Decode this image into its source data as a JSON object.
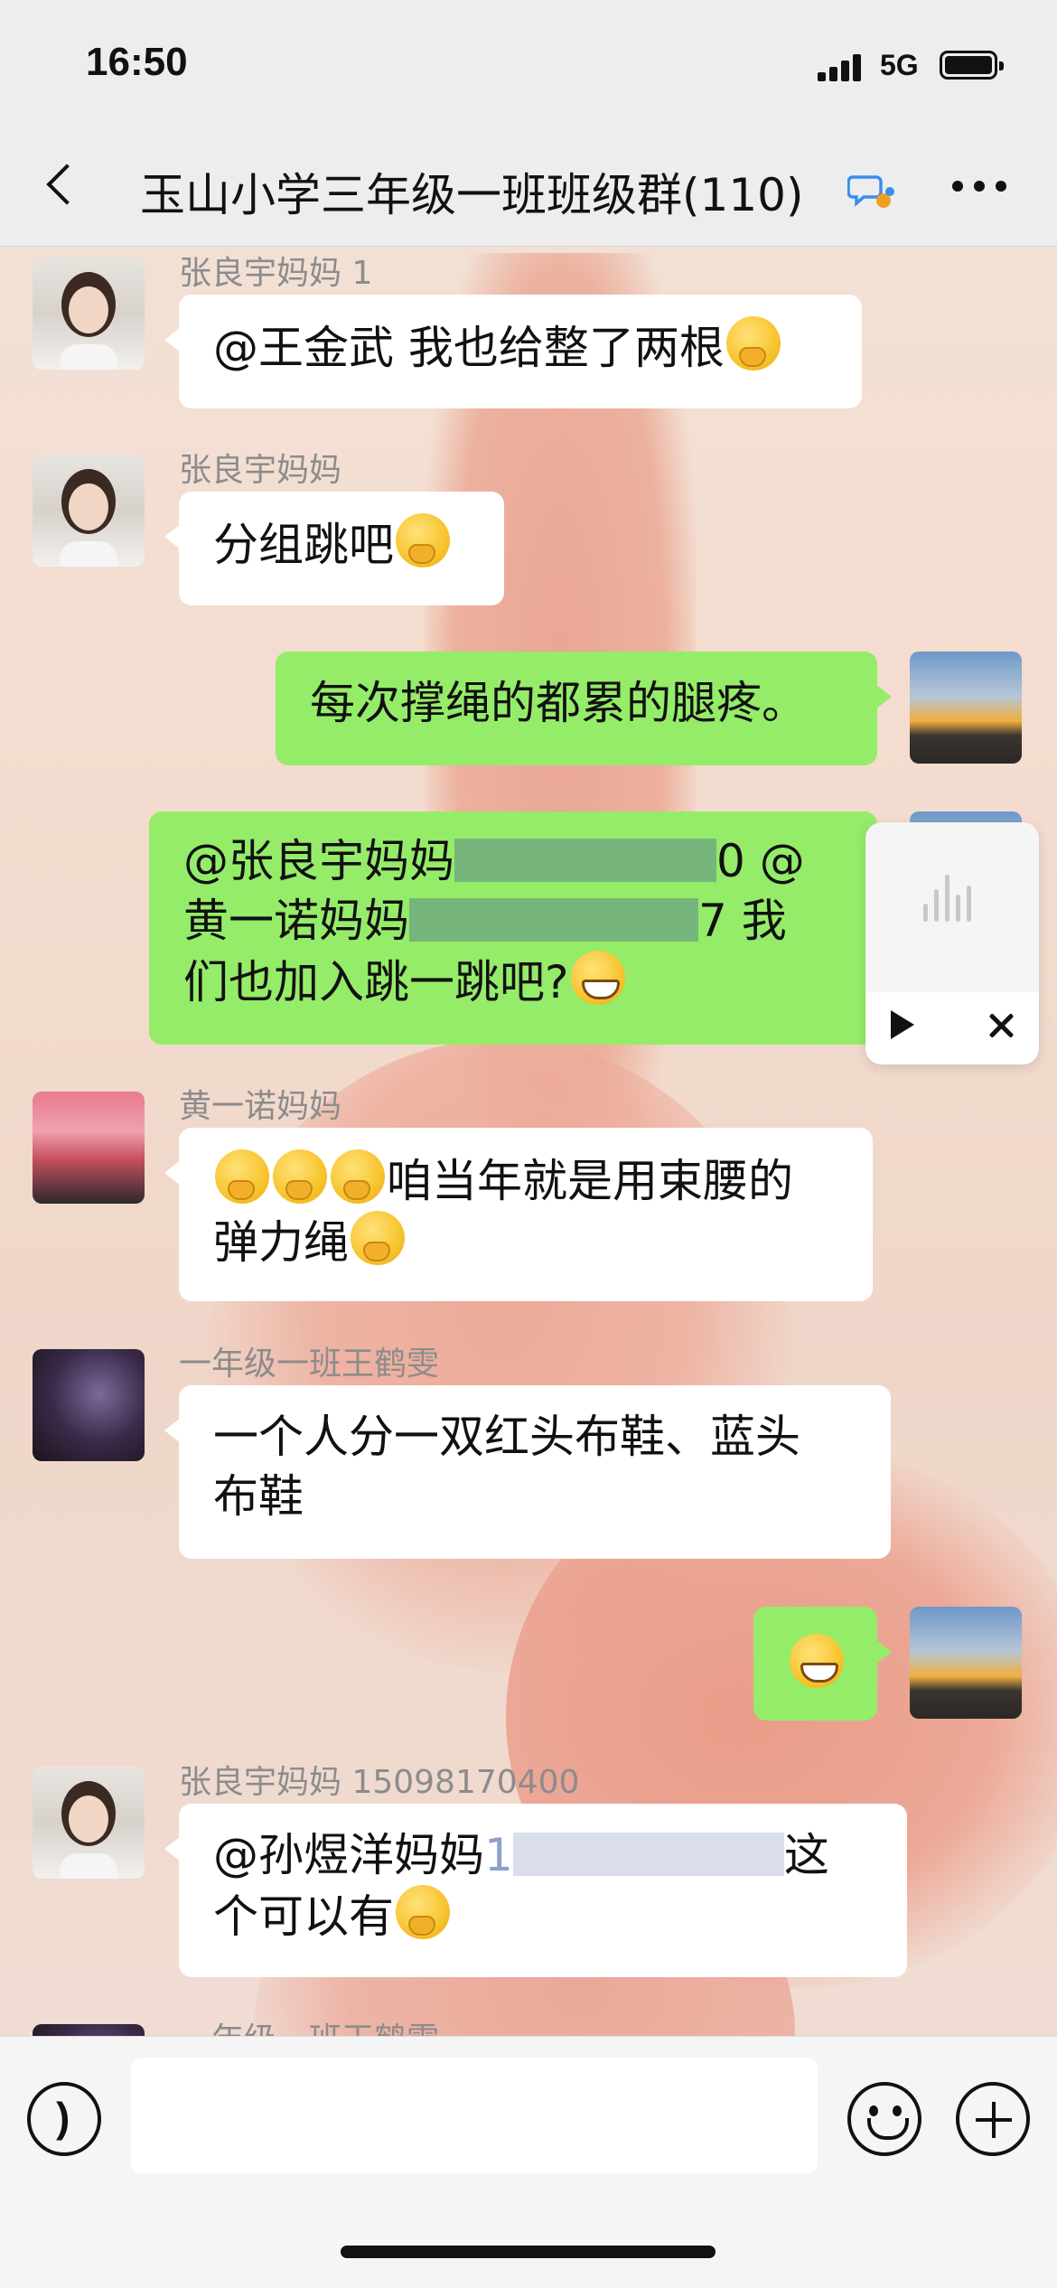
{
  "status_bar": {
    "time": "16:50",
    "network": "5G"
  },
  "header": {
    "title": "玉山小学三年级一班班级群(110)"
  },
  "messages": [
    {
      "side": "in",
      "sender": "张良宇妈妈 1",
      "text": "@王金武 我也给整了两根",
      "emoji": [
        "thinking"
      ]
    },
    {
      "side": "in",
      "sender": "张良宇妈妈",
      "text": "分组跳吧",
      "emoji": [
        "thinking"
      ]
    },
    {
      "side": "out",
      "text": "每次撑绳的都累的腿疼。"
    },
    {
      "side": "out",
      "line1": "@张良宇妈妈",
      "line1_end": "0 @",
      "line2": "黄一诺妈妈",
      "line2_end": "7 我",
      "line3": "们也加入跳一跳吧?",
      "emoji": [
        "grin"
      ]
    },
    {
      "side": "in",
      "sender": "黄一诺妈妈",
      "line1": "咱当年就是用束腰的",
      "line2": "弹力绳",
      "emoji": [
        "thinking",
        "thinking",
        "thinking",
        "thinking"
      ]
    },
    {
      "side": "in",
      "sender": "一年级一班王鹤雯",
      "line1": "一个人分一双红头布鞋、蓝头",
      "line2": "布鞋"
    },
    {
      "side": "out",
      "text": "",
      "emoji": [
        "grin"
      ]
    },
    {
      "side": "in",
      "sender": "张良宇妈妈 15098170400",
      "line1": "@孙煜洋妈妈",
      "line1_prefix_digit": "1",
      "line1_end": "这",
      "line2": "个可以有",
      "emoji": [
        "thinking"
      ]
    },
    {
      "side": "in",
      "sender": "一年级一班王鹤雯"
    }
  ],
  "input": {
    "placeholder": ""
  },
  "icons": {
    "back": "chevron-left-icon",
    "group_chat": "chat-bubbles-icon",
    "more": "more-dots-icon",
    "voice": "voice-icon",
    "emoji": "smiley-icon",
    "plus": "plus-icon",
    "play": "play-icon",
    "close": "close-icon"
  },
  "colors": {
    "out_bubble": "#95ec69",
    "in_bubble": "#ffffff",
    "header_bg": "#ededed"
  }
}
